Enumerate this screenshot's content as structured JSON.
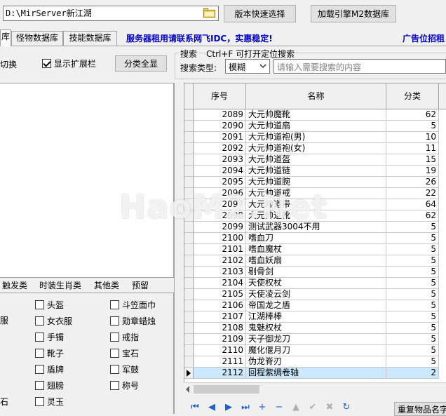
{
  "top": {
    "path_value": "D:\\MirServer新江湖",
    "version_select_btn": "版本快速选择",
    "load_engine_btn": "加载引擎M2数据库"
  },
  "tabs": [
    {
      "label": "库"
    },
    {
      "label": "怪物数据库"
    },
    {
      "label": "技能数据库"
    }
  ],
  "promo_text": "服务器租用请联系网飞IDC，实惠稳定!",
  "ad_text": "广告位招租",
  "toolbar": {
    "switch_label": "切换",
    "show_ext_label": "显示扩展栏",
    "show_ext_checked": true,
    "show_all_btn": "分类全显"
  },
  "search": {
    "group_label": "搜索",
    "shortcut_hint": "Ctrl+F 可打开定位搜索",
    "type_label": "搜索类型:",
    "type_value": "模糊",
    "placeholder": "请输入需要搜索的内容"
  },
  "category_tabs": [
    {
      "label": "触发类"
    },
    {
      "label": "时装生肖类"
    },
    {
      "label": "其他类"
    },
    {
      "label": "预留"
    }
  ],
  "category_items_left": [
    {
      "label": "头盔"
    },
    {
      "label": "女衣服"
    },
    {
      "label": "手镯"
    },
    {
      "label": "靴子"
    },
    {
      "label": "盾牌"
    },
    {
      "label": "翅膀"
    },
    {
      "label": "灵玉"
    }
  ],
  "category_items_right": [
    {
      "label": "斗笠面巾"
    },
    {
      "label": "勋章蜡烛"
    },
    {
      "label": "戒指"
    },
    {
      "label": "宝石"
    },
    {
      "label": "军鼓"
    },
    {
      "label": "称号"
    }
  ],
  "category_fragments": [
    {
      "label": "服"
    },
    {
      "label": "石"
    }
  ],
  "grid": {
    "columns": [
      "序号",
      "名称",
      "分类"
    ],
    "rows": [
      {
        "id": "2089",
        "name": "大元帅魔靴",
        "cat": "62"
      },
      {
        "id": "2090",
        "name": "大元帅道扇",
        "cat": "5"
      },
      {
        "id": "2091",
        "name": "大元帅道袍(男)",
        "cat": "10"
      },
      {
        "id": "2092",
        "name": "大元帅道袍(女)",
        "cat": "11"
      },
      {
        "id": "2093",
        "name": "大元帅道盔",
        "cat": "15"
      },
      {
        "id": "2094",
        "name": "大元帅道链",
        "cat": "19"
      },
      {
        "id": "2095",
        "name": "大元帅道腕",
        "cat": "26"
      },
      {
        "id": "2096",
        "name": "大元帅道戒",
        "cat": "22"
      },
      {
        "id": "2097",
        "name": "大元帅道带",
        "cat": "64"
      },
      {
        "id": "2098",
        "name": "大元帅道靴",
        "cat": "62"
      },
      {
        "id": "2099",
        "name": "测试武器3004不用",
        "cat": "5"
      },
      {
        "id": "2100",
        "name": "嗜血刀",
        "cat": "5"
      },
      {
        "id": "2101",
        "name": "嗜血魔杖",
        "cat": "5"
      },
      {
        "id": "2102",
        "name": "嗜血妖扇",
        "cat": "5"
      },
      {
        "id": "2103",
        "name": "剔骨剑",
        "cat": "5"
      },
      {
        "id": "2104",
        "name": "天使权杖",
        "cat": "5"
      },
      {
        "id": "2105",
        "name": "天使凌云剑",
        "cat": "5"
      },
      {
        "id": "2106",
        "name": "帝国龙之盾",
        "cat": "5"
      },
      {
        "id": "2107",
        "name": "江湖棒棒",
        "cat": "5"
      },
      {
        "id": "2108",
        "name": "鬼魅权杖",
        "cat": "5"
      },
      {
        "id": "2109",
        "name": "天子御龙刀",
        "cat": "5"
      },
      {
        "id": "2110",
        "name": "魔化偃月刀",
        "cat": "5"
      },
      {
        "id": "2111",
        "name": "伪龙脊刃",
        "cat": "5"
      },
      {
        "id": "2112",
        "name": "回程紫绸卷轴",
        "cat": "2"
      }
    ]
  },
  "navigator": [
    {
      "icon": "first-icon",
      "glyph": "⏮"
    },
    {
      "icon": "prior-icon",
      "glyph": "◀"
    },
    {
      "icon": "next-icon",
      "glyph": "▶"
    },
    {
      "icon": "last-icon",
      "glyph": "⏭"
    },
    {
      "icon": "insert-icon",
      "glyph": "+"
    },
    {
      "icon": "delete-icon",
      "glyph": "−"
    },
    {
      "icon": "edit-icon",
      "glyph": "▲"
    },
    {
      "icon": "post-icon",
      "glyph": "✔"
    },
    {
      "icon": "cancel-icon",
      "glyph": "✖"
    },
    {
      "icon": "refresh-icon",
      "glyph": "↻"
    }
  ],
  "dup_btn": "重复物品名字",
  "watermark": "HaoM2.Net"
}
